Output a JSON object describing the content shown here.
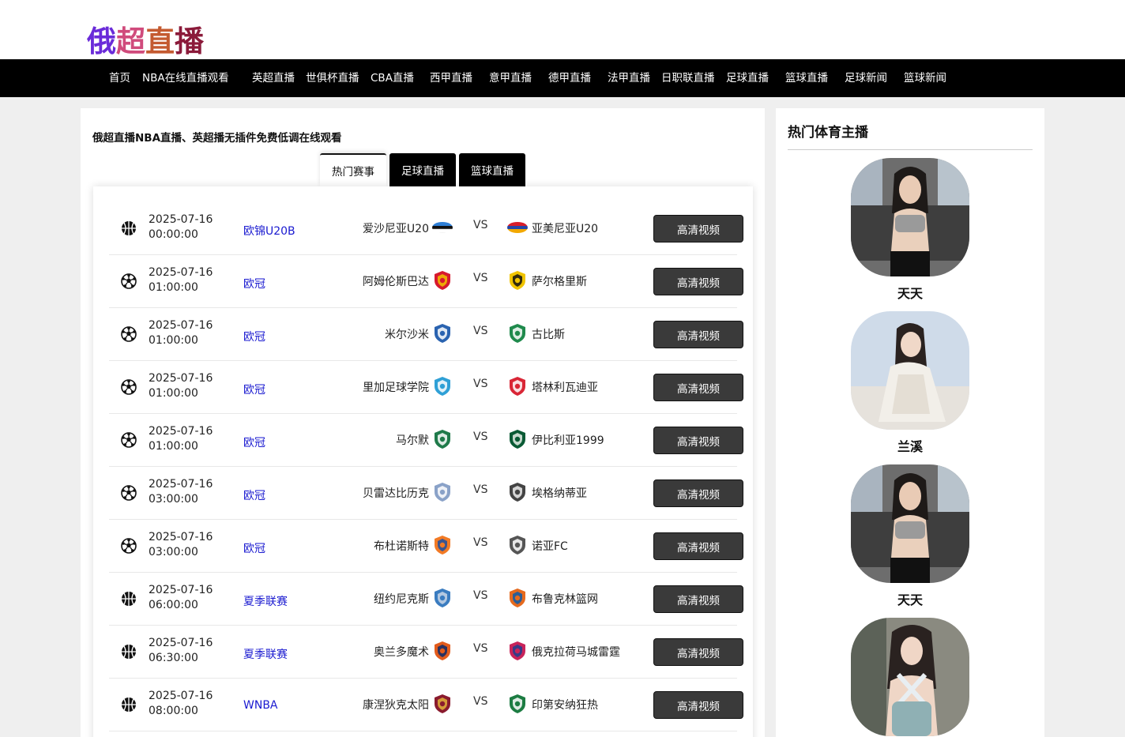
{
  "site": {
    "logo_chars": [
      {
        "text": "俄",
        "color": "#6a2bd9"
      },
      {
        "text": "超",
        "color": "#d04b7c"
      },
      {
        "text": "直",
        "color": "#c45a30"
      },
      {
        "text": "播",
        "color": "#8b1a3a"
      }
    ]
  },
  "nav": {
    "items": [
      {
        "label": "首页"
      },
      {
        "label": "NBA在线直播观看"
      },
      {
        "label": "英超直播"
      },
      {
        "label": "世俱杯直播"
      },
      {
        "label": "CBA直播"
      },
      {
        "label": "西甲直播"
      },
      {
        "label": "意甲直播"
      },
      {
        "label": "德甲直播"
      },
      {
        "label": "法甲直播"
      },
      {
        "label": "日职联直播"
      },
      {
        "label": "足球直播"
      },
      {
        "label": "篮球直播"
      },
      {
        "label": "足球新闻"
      },
      {
        "label": "篮球新闻"
      }
    ]
  },
  "main": {
    "title": "俄超直播NBA直播、英超播无插件免费低调在线观看",
    "tabs": [
      {
        "label": "热门赛事"
      },
      {
        "label": "足球直播"
      },
      {
        "label": "篮球直播"
      }
    ]
  },
  "matches": [
    {
      "sport_icon": "basketball-icon",
      "date": "2025-07-16",
      "time": "00:00:00",
      "league": "欧锦U20B",
      "home": "爱沙尼亚U20",
      "home_logo": "estonia-flag-icon",
      "vs": "VS",
      "away": "亚美尼亚U20",
      "away_logo": "armenia-flag-icon",
      "button": "高清视频"
    },
    {
      "sport_icon": "soccer-ball-icon",
      "date": "2025-07-16",
      "time": "01:00:00",
      "league": "欧冠",
      "home": "阿姆伦斯巴达",
      "home_logo": "club-crest-icon",
      "vs": "VS",
      "away": "萨尔格里斯",
      "away_logo": "club-crest-icon",
      "button": "高清视频"
    },
    {
      "sport_icon": "soccer-ball-icon",
      "date": "2025-07-16",
      "time": "01:00:00",
      "league": "欧冠",
      "home": "米尔沙米",
      "home_logo": "club-crest-icon",
      "vs": "VS",
      "away": "古比斯",
      "away_logo": "club-crest-icon",
      "button": "高清视频"
    },
    {
      "sport_icon": "soccer-ball-icon",
      "date": "2025-07-16",
      "time": "01:00:00",
      "league": "欧冠",
      "home": "里加足球学院",
      "home_logo": "club-crest-icon",
      "vs": "VS",
      "away": "塔林利瓦迪亚",
      "away_logo": "club-crest-icon",
      "button": "高清视频"
    },
    {
      "sport_icon": "soccer-ball-icon",
      "date": "2025-07-16",
      "time": "01:00:00",
      "league": "欧冠",
      "home": "马尔默",
      "home_logo": "club-crest-icon",
      "vs": "VS",
      "away": "伊比利亚1999",
      "away_logo": "club-crest-icon",
      "button": "高清视频"
    },
    {
      "sport_icon": "soccer-ball-icon",
      "date": "2025-07-16",
      "time": "03:00:00",
      "league": "欧冠",
      "home": "贝雷达比历克",
      "home_logo": "club-crest-icon",
      "vs": "VS",
      "away": "埃格纳蒂亚",
      "away_logo": "club-crest-icon",
      "button": "高清视频"
    },
    {
      "sport_icon": "soccer-ball-icon",
      "date": "2025-07-16",
      "time": "03:00:00",
      "league": "欧冠",
      "home": "布杜诺斯特",
      "home_logo": "club-crest-icon",
      "vs": "VS",
      "away": "诺亚FC",
      "away_logo": "club-crest-icon",
      "button": "高清视频"
    },
    {
      "sport_icon": "basketball-icon",
      "date": "2025-07-16",
      "time": "06:00:00",
      "league": "夏季联赛",
      "home": "纽约尼克斯",
      "home_logo": "knicks-logo-icon",
      "vs": "VS",
      "away": "布鲁克林篮网",
      "away_logo": "nets-logo-icon",
      "button": "高清视频"
    },
    {
      "sport_icon": "basketball-icon",
      "date": "2025-07-16",
      "time": "06:30:00",
      "league": "夏季联赛",
      "home": "奥兰多魔术",
      "home_logo": "magic-logo-icon",
      "vs": "VS",
      "away": "俄克拉荷马城雷霆",
      "away_logo": "thunder-logo-icon",
      "button": "高清视频"
    },
    {
      "sport_icon": "basketball-icon",
      "date": "2025-07-16",
      "time": "08:00:00",
      "league": "WNBA",
      "home": "康涅狄克太阳",
      "home_logo": "sun-logo-icon",
      "vs": "VS",
      "away": "印第安纳狂热",
      "away_logo": "fever-logo-icon",
      "button": "高清视频"
    }
  ],
  "sidebar": {
    "title": "热门体育主播",
    "anchors": [
      {
        "name": "天天"
      },
      {
        "name": "兰溪"
      },
      {
        "name": "天天"
      },
      {
        "name": ""
      }
    ]
  }
}
